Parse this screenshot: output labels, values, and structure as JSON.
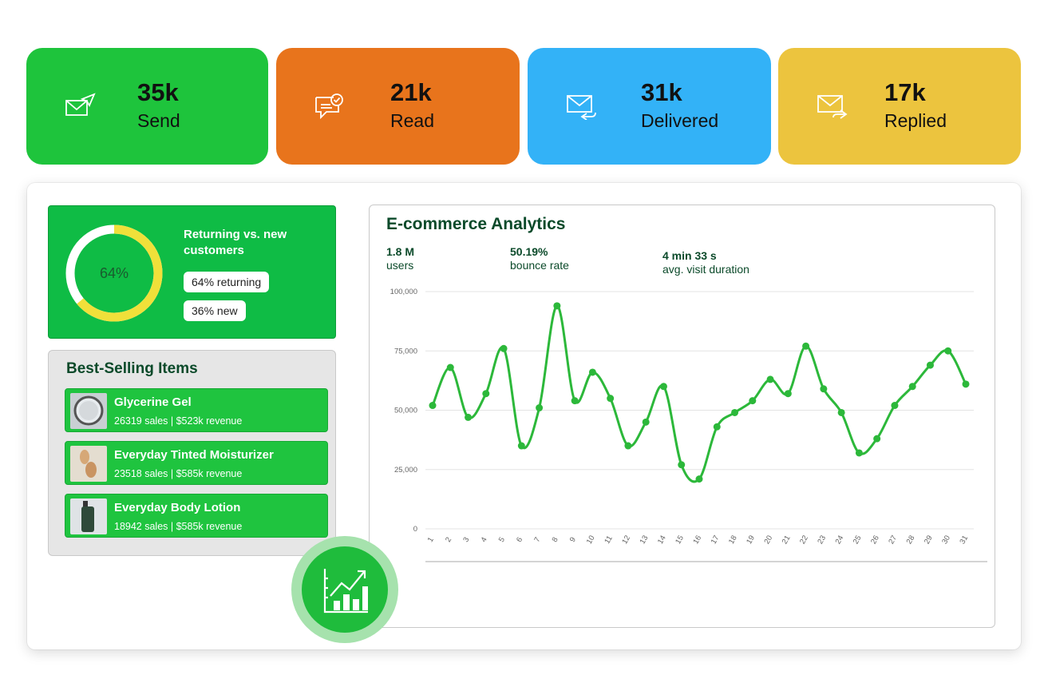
{
  "stats": [
    {
      "value": "35k",
      "label": "Send",
      "color": "#1ec43c",
      "icon": "send-mail-icon"
    },
    {
      "value": "21k",
      "label": "Read",
      "color": "#e8741c",
      "icon": "chat-check-icon"
    },
    {
      "value": "31k",
      "label": "Delivered",
      "color": "#33b2f7",
      "icon": "mail-reply-icon"
    },
    {
      "value": "17k",
      "label": "Replied",
      "color": "#ecc43e",
      "icon": "mail-forward-icon"
    }
  ],
  "customers": {
    "percent_label": "64%",
    "returning_fraction": 0.64,
    "title": "Returning vs. new customers",
    "returning_label": "64% returning",
    "new_label": "36% new",
    "ring_color": "#f0e03a"
  },
  "best_selling": {
    "title": "Best-Selling Items",
    "items": [
      {
        "name": "Glycerine Gel",
        "meta": "26319 sales | $523k revenue"
      },
      {
        "name": "Everyday Tinted Moisturizer",
        "meta": "23518 sales | $585k revenue"
      },
      {
        "name": "Everyday Body Lotion",
        "meta": "18942 sales | $585k revenue"
      }
    ]
  },
  "analytics": {
    "title": "E-commerce Analytics",
    "metrics": [
      {
        "value": "1.8 M",
        "label": "users"
      },
      {
        "value": "50.19%",
        "label": "bounce rate"
      },
      {
        "value": "4 min 33 s",
        "label": "avg. visit duration"
      }
    ]
  },
  "chart_data": {
    "type": "line",
    "title": "",
    "xlabel": "",
    "ylabel": "",
    "ylim": [
      0,
      100000
    ],
    "yticks": [
      0,
      25000,
      50000,
      75000,
      100000
    ],
    "ytick_labels": [
      "0",
      "25,000",
      "50,000",
      "75,000",
      "100,000"
    ],
    "x": [
      "1",
      "2",
      "3",
      "4",
      "5",
      "6",
      "7",
      "8",
      "9",
      "10",
      "11",
      "12",
      "13",
      "14",
      "15",
      "16",
      "17",
      "18",
      "19",
      "20",
      "21",
      "22",
      "23",
      "24",
      "25",
      "26",
      "27",
      "28",
      "29",
      "30",
      "31"
    ],
    "values": [
      52000,
      68000,
      47000,
      57000,
      76000,
      35000,
      51000,
      94000,
      54000,
      66000,
      55000,
      35000,
      45000,
      60000,
      27000,
      21000,
      43000,
      49000,
      54000,
      63000,
      57000,
      77000,
      59000,
      49000,
      32000,
      38000,
      52000,
      60000,
      69000,
      75000,
      61000
    ],
    "line_color": "#2cb83a",
    "grid": true
  }
}
